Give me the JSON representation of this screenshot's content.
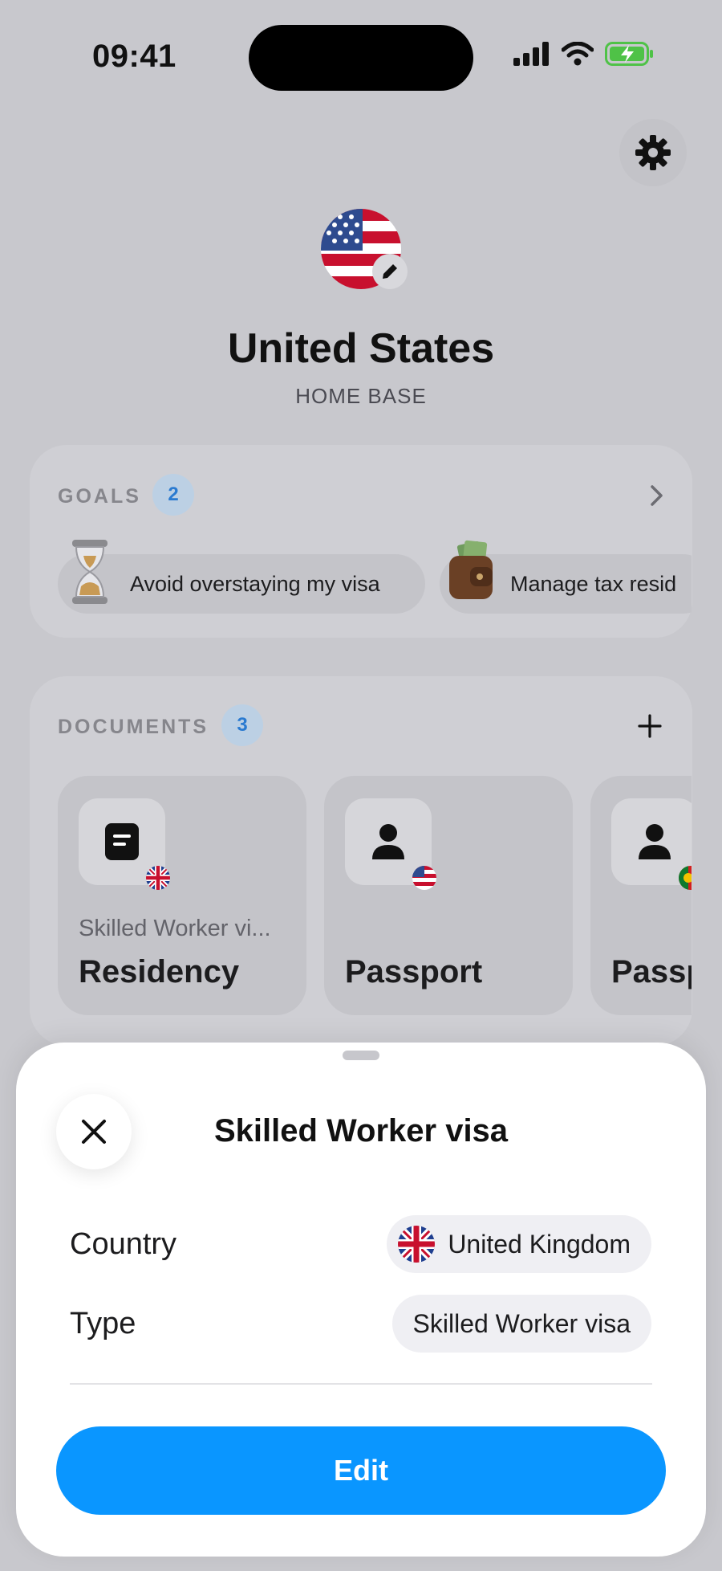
{
  "status_bar": {
    "time": "09:41"
  },
  "home": {
    "country": "United States",
    "subtitle": "HOME BASE"
  },
  "goals": {
    "label": "GOALS",
    "count": "2",
    "items": [
      {
        "emoji": "hourglass-icon",
        "text": "Avoid overstaying my visa"
      },
      {
        "emoji": "wallet-icon",
        "text": "Manage tax resid"
      }
    ]
  },
  "documents": {
    "label": "DOCUMENTS",
    "count": "3",
    "items": [
      {
        "subtitle": "Skilled Worker vi...",
        "title": "Residency",
        "icon": "document-icon",
        "flag": "uk-flag-icon"
      },
      {
        "subtitle": "",
        "title": "Passport",
        "icon": "person-icon",
        "flag": "us-flag-icon"
      },
      {
        "subtitle": "",
        "title": "Passp",
        "icon": "person-icon",
        "flag": "portugal-flag-icon"
      }
    ]
  },
  "sheet": {
    "title": "Skilled Worker visa",
    "rows": [
      {
        "label": "Country",
        "value": "United Kingdom"
      },
      {
        "label": "Type",
        "value": "Skilled Worker visa"
      }
    ],
    "edit_label": "Edit"
  },
  "colors": {
    "accent": "#0a96ff",
    "badge_text": "#2a7ad0",
    "dim_background": "#c8c8cd"
  }
}
